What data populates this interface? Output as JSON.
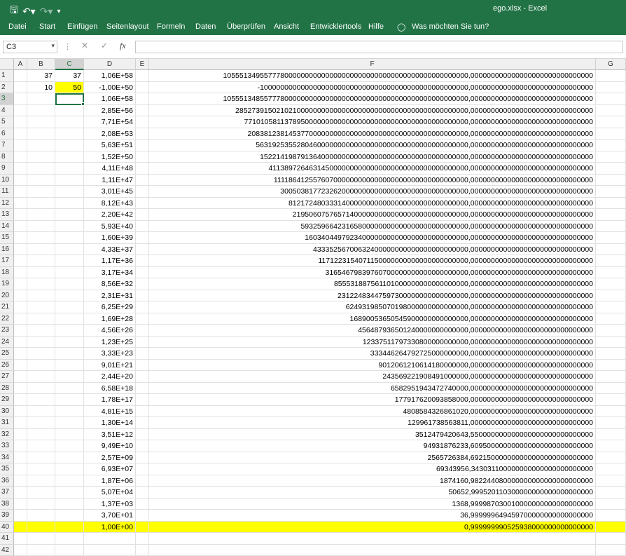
{
  "titlebar": {
    "title": "ego.xlsx  -  Excel",
    "save_icon": "save-icon",
    "undo_icon": "undo-icon",
    "redo_icon": "redo-icon",
    "qat_icon": "customize-qat-icon"
  },
  "ribbon": {
    "tabs": [
      "Datei",
      "Start",
      "Einfügen",
      "Seitenlayout",
      "Formeln",
      "Daten",
      "Überprüfen",
      "Ansicht",
      "Entwicklertools",
      "Hilfe"
    ],
    "tell_me": "Was möchten Sie tun?",
    "tell_me_icon": "lightbulb-icon"
  },
  "formula_bar": {
    "name_box": "C3",
    "cancel_icon": "cancel-icon",
    "enter_icon": "enter-icon",
    "fx_label": "fx",
    "formula": ""
  },
  "colors": {
    "accent": "#217346",
    "highlight": "#ffff00"
  },
  "columns": [
    "A",
    "B",
    "C",
    "D",
    "E",
    "F",
    "G"
  ],
  "active_cell": "C3",
  "rows": [
    {
      "n": "1",
      "b": "37",
      "c": "37",
      "d": "1,06E+58",
      "f": "105551349557778000000000000000000000000000000000000000000000,000000000000000000000000000000"
    },
    {
      "n": "2",
      "b": "10",
      "c": "50",
      "d": "-1,00E+50",
      "f": "-100000000000000000000000000000000000000000000000000,000000000000000000000000000000"
    },
    {
      "n": "3",
      "b": "",
      "c": "",
      "d": "1,06E+58",
      "f": "105551348557778000000000000000000000000000000000000000000000,000000000000000000000000000000"
    },
    {
      "n": "4",
      "b": "",
      "c": "",
      "d": "2,85E+56",
      "f": "285273915021021000000000000000000000000000000000000000000,000000000000000000000000000000"
    },
    {
      "n": "5",
      "b": "",
      "c": "",
      "d": "7,71E+54",
      "f": "7710105811378950000000000000000000000000000000000000000,000000000000000000000000000000"
    },
    {
      "n": "6",
      "b": "",
      "c": "",
      "d": "2,08E+53",
      "f": "208381238145377000000000000000000000000000000000000000,000000000000000000000000000000"
    },
    {
      "n": "7",
      "b": "",
      "c": "",
      "d": "5,63E+51",
      "f": "5631925355280460000000000000000000000000000000000000,000000000000000000000000000000"
    },
    {
      "n": "8",
      "b": "",
      "c": "",
      "d": "1,52E+50",
      "f": "152214198791364000000000000000000000000000000000000,000000000000000000000000000000"
    },
    {
      "n": "9",
      "b": "",
      "c": "",
      "d": "4,11E+48",
      "f": "4113897264631450000000000000000000000000000000000,000000000000000000000000000000"
    },
    {
      "n": "10",
      "b": "",
      "c": "",
      "d": "1,11E+47",
      "f": "111186412557607000000000000000000000000000000000,000000000000000000000000000000"
    },
    {
      "n": "11",
      "b": "",
      "c": "",
      "d": "3,01E+45",
      "f": "3005038177232620000000000000000000000000000000,000000000000000000000000000000"
    },
    {
      "n": "12",
      "b": "",
      "c": "",
      "d": "8,12E+43",
      "f": "81217248033314000000000000000000000000000000,000000000000000000000000000000"
    },
    {
      "n": "13",
      "b": "",
      "c": "",
      "d": "2,20E+42",
      "f": "2195060757657140000000000000000000000000000,000000000000000000000000000000"
    },
    {
      "n": "14",
      "b": "",
      "c": "",
      "d": "5,93E+40",
      "f": "59325966423165800000000000000000000000000,000000000000000000000000000000"
    },
    {
      "n": "15",
      "b": "",
      "c": "",
      "d": "1,60E+39",
      "f": "1603404497923400000000000000000000000000,000000000000000000000000000000"
    },
    {
      "n": "16",
      "b": "",
      "c": "",
      "d": "4,33E+37",
      "f": "43335256700632400000000000000000000000,000000000000000000000000000000"
    },
    {
      "n": "17",
      "b": "",
      "c": "",
      "d": "1,17E+36",
      "f": "1171223154071150000000000000000000000,000000000000000000000000000000"
    },
    {
      "n": "18",
      "b": "",
      "c": "",
      "d": "3,17E+34",
      "f": "31654679839760700000000000000000000,000000000000000000000000000000"
    },
    {
      "n": "19",
      "b": "",
      "c": "",
      "d": "8,56E+32",
      "f": "855531887561101000000000000000000,000000000000000000000000000000"
    },
    {
      "n": "20",
      "b": "",
      "c": "",
      "d": "2,31E+31",
      "f": "23122483447597300000000000000000,000000000000000000000000000000"
    },
    {
      "n": "21",
      "b": "",
      "c": "",
      "d": "6,25E+29",
      "f": "624931985070198000000000000000,000000000000000000000000000000"
    },
    {
      "n": "22",
      "b": "",
      "c": "",
      "d": "1,69E+28",
      "f": "16890053650545900000000000000,000000000000000000000000000000"
    },
    {
      "n": "23",
      "b": "",
      "c": "",
      "d": "4,56E+26",
      "f": "456487936501240000000000000,000000000000000000000000000000"
    },
    {
      "n": "24",
      "b": "",
      "c": "",
      "d": "1,23E+25",
      "f": "12337511797330800000000000,000000000000000000000000000000"
    },
    {
      "n": "25",
      "b": "",
      "c": "",
      "d": "3,33E+23",
      "f": "333446264792725000000000,000000000000000000000000000000"
    },
    {
      "n": "26",
      "b": "",
      "c": "",
      "d": "9,01E+21",
      "f": "9012061210614180000000,000000000000000000000000000000"
    },
    {
      "n": "27",
      "b": "",
      "c": "",
      "d": "2,44E+20",
      "f": "243569221908491000000,000000000000000000000000000000"
    },
    {
      "n": "28",
      "b": "",
      "c": "",
      "d": "6,58E+18",
      "f": "6582951943472740000,000000000000000000000000000000"
    },
    {
      "n": "29",
      "b": "",
      "c": "",
      "d": "1,78E+17",
      "f": "177917620093858000,000000000000000000000000000000"
    },
    {
      "n": "30",
      "b": "",
      "c": "",
      "d": "4,81E+15",
      "f": "4808584326861020,000000000000000000000000000000"
    },
    {
      "n": "31",
      "b": "",
      "c": "",
      "d": "1,30E+14",
      "f": "129961738563811,000000000000000000000000000000"
    },
    {
      "n": "32",
      "b": "",
      "c": "",
      "d": "3,51E+12",
      "f": "3512479420643,550000000000000000000000000000"
    },
    {
      "n": "33",
      "b": "",
      "c": "",
      "d": "9,49E+10",
      "f": "94931876233,609500000000000000000000000000"
    },
    {
      "n": "34",
      "b": "",
      "c": "",
      "d": "2,57E+09",
      "f": "2565726384,692150000000000000000000000000"
    },
    {
      "n": "35",
      "b": "",
      "c": "",
      "d": "6,93E+07",
      "f": "69343956,343031100000000000000000000000"
    },
    {
      "n": "36",
      "b": "",
      "c": "",
      "d": "1,87E+06",
      "f": "1874160,982244080000000000000000000000"
    },
    {
      "n": "37",
      "b": "",
      "c": "",
      "d": "5,07E+04",
      "f": "50652,999520110300000000000000000000"
    },
    {
      "n": "38",
      "b": "",
      "c": "",
      "d": "1,37E+03",
      "f": "1368,999987030010000000000000000000"
    },
    {
      "n": "39",
      "b": "",
      "c": "",
      "d": "3,70E+01",
      "f": "36,999999649459700000000000000000"
    },
    {
      "n": "40",
      "b": "",
      "c": "",
      "d": "1,00E+00",
      "f": "0,999999990525938000000000000000"
    },
    {
      "n": "41",
      "b": "",
      "c": "",
      "d": "",
      "f": ""
    },
    {
      "n": "42",
      "b": "",
      "c": "",
      "d": "",
      "f": ""
    }
  ]
}
